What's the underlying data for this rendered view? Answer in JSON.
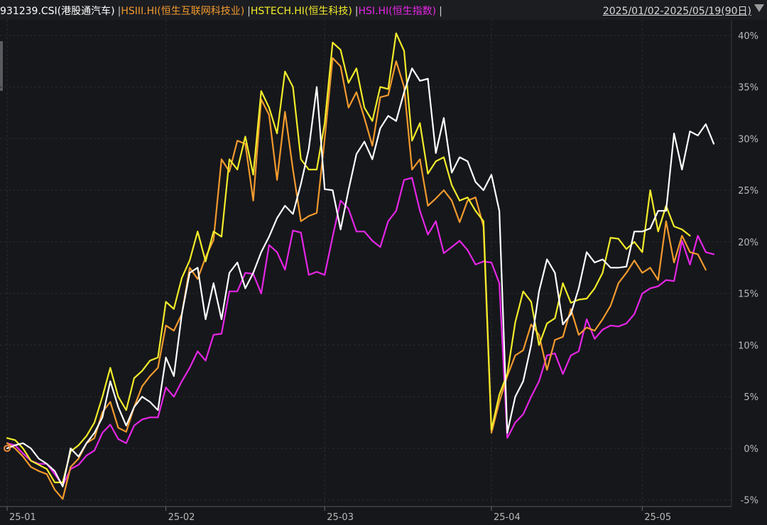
{
  "header": {
    "series_labels": [
      {
        "text": "931239.CSI(港股通汽车)",
        "color": "#ffffff"
      },
      {
        "text": "HSIII.HI(恒生互联网科技业)",
        "color": "#f29a2e"
      },
      {
        "text": "HSTECH.HI(恒生科技)",
        "color": "#f2ec2a"
      },
      {
        "text": "HSI.HI(恒生指数)",
        "color": "#e626e6"
      }
    ],
    "separator": "|",
    "date_range": "2025/01/02-2025/05/19(90日)",
    "dropdown_icon": "triangle-down-icon"
  },
  "chart_data": {
    "type": "line",
    "n_points": 90,
    "ylim": [
      -5.5,
      41.5
    ],
    "y_ticks": [
      -5,
      0,
      5,
      10,
      15,
      20,
      25,
      30,
      35,
      40
    ],
    "y_tick_labels": [
      "-5%",
      "0%",
      "5%",
      "10%",
      "15%",
      "20%",
      "25%",
      "30%",
      "35%",
      "40%"
    ],
    "x_ticks": [
      {
        "label": "25-01",
        "index": 0
      },
      {
        "label": "25-02",
        "index": 20
      },
      {
        "label": "25-03",
        "index": 40
      },
      {
        "label": "25-04",
        "index": 61
      },
      {
        "label": "25-05",
        "index": 80
      }
    ],
    "grid": true,
    "series": [
      {
        "color": "#e626e6",
        "values": [
          0.5,
          0.3,
          -0.5,
          -1.2,
          -1.5,
          -1.5,
          -2.5,
          -3.6,
          -2.0,
          -1.6,
          -0.7,
          -0.2,
          1.5,
          2.3,
          0.9,
          0.5,
          2.2,
          2.8,
          3.0,
          3.0,
          5.9,
          5.0,
          6.5,
          7.8,
          9.4,
          8.5,
          11.0,
          11.1,
          15.2,
          15.2,
          17.0,
          16.9,
          15.0,
          19.7,
          19.0,
          17.3,
          21.1,
          20.9,
          16.8,
          17.1,
          16.8,
          20.5,
          24.0,
          23.2,
          21.0,
          21.0,
          20.1,
          19.5,
          22.0,
          23.0,
          26.0,
          26.2,
          23.0,
          20.7,
          22.0,
          18.9,
          19.5,
          20.1,
          19.2,
          17.8,
          18.1,
          18.0,
          16.0,
          1.0,
          2.5,
          3.3,
          5.0,
          6.5,
          9.0,
          9.2,
          7.2,
          9.0,
          9.4,
          12.5,
          10.6,
          11.5,
          11.9,
          11.8,
          12.1,
          13.0,
          15.0,
          15.5,
          15.7,
          16.3,
          16.2,
          20.1,
          17.8,
          20.6,
          19.0,
          18.8
        ]
      },
      {
        "color": "#f29a2e",
        "values": [
          0.5,
          0.0,
          -0.8,
          -1.8,
          -2.2,
          -2.5,
          -4.0,
          -4.9,
          -1.8,
          -1.0,
          0.5,
          1.0,
          3.5,
          4.5,
          2.0,
          1.6,
          4.0,
          6.0,
          7.0,
          7.8,
          11.9,
          11.4,
          13.0,
          17.5,
          16.4,
          18.5,
          20.2,
          28.0,
          26.8,
          29.8,
          29.5,
          24.0,
          33.8,
          32.3,
          26.0,
          32.6,
          27.0,
          22.0,
          22.5,
          22.8,
          30.0,
          37.8,
          37.0,
          33.0,
          34.5,
          32.0,
          29.3,
          34.0,
          34.2,
          37.5,
          35.0,
          27.0,
          28.0,
          23.5,
          24.2,
          25.0,
          24.0,
          21.9,
          24.0,
          24.3,
          21.5,
          1.5,
          4.5,
          7.0,
          9.0,
          9.5,
          12.0,
          11.0,
          7.6,
          10.5,
          10.8,
          13.5,
          11.0,
          11.7,
          11.4,
          12.5,
          13.8,
          16.0,
          17.0,
          18.2,
          17.0,
          17.5,
          16.3,
          22.0,
          18.0,
          20.6,
          19.0,
          18.8,
          17.3
        ]
      },
      {
        "color": "#f2ec2a",
        "values": [
          1.0,
          0.8,
          0.0,
          -1.2,
          -1.6,
          -2.0,
          -3.3,
          -3.3,
          -0.3,
          0.3,
          1.2,
          2.5,
          5.0,
          7.8,
          5.0,
          3.7,
          6.8,
          7.5,
          8.5,
          8.8,
          14.2,
          13.5,
          16.5,
          18.2,
          21.0,
          18.1,
          21.0,
          20.5,
          28.0,
          27.0,
          30.2,
          26.5,
          34.6,
          33.0,
          30.5,
          36.5,
          35.0,
          28.0,
          27.0,
          27.0,
          31.5,
          39.3,
          38.6,
          35.4,
          36.8,
          33.0,
          31.7,
          35.0,
          34.8,
          40.2,
          38.5,
          29.8,
          31.5,
          26.6,
          27.8,
          28.2,
          25.5,
          24.0,
          24.3,
          23.0,
          22.0,
          1.8,
          5.2,
          7.2,
          12.2,
          15.2,
          14.2,
          10.0,
          12.1,
          12.6,
          16.0,
          14.1,
          14.4,
          14.5,
          15.5,
          17.0,
          20.4,
          20.3,
          19.3,
          20.0,
          19.0,
          25.0,
          21.0,
          23.5,
          21.5,
          21.2,
          20.6
        ]
      },
      {
        "color": "#ffffff",
        "values": [
          0.0,
          0.3,
          0.5,
          0.0,
          -1.0,
          -1.5,
          -2.2,
          -3.7,
          0.0,
          -0.8,
          0.5,
          1.5,
          3.0,
          6.5,
          4.0,
          2.2,
          4.0,
          5.0,
          4.5,
          3.7,
          8.8,
          7.0,
          13.0,
          17.0,
          17.5,
          12.5,
          16.0,
          12.5,
          17.0,
          18.0,
          15.5,
          17.0,
          19.0,
          20.5,
          22.3,
          23.5,
          22.7,
          25.6,
          29.0,
          35.0,
          25.1,
          25.0,
          21.2,
          25.0,
          28.5,
          29.7,
          28.0,
          31.0,
          32.2,
          31.7,
          34.5,
          36.8,
          35.6,
          35.8,
          28.6,
          32.0,
          26.7,
          28.2,
          27.8,
          25.8,
          25.0,
          26.5,
          23.0,
          1.5,
          5.0,
          6.5,
          10.0,
          15.2,
          18.3,
          17.0,
          12.0,
          13.0,
          15.5,
          19.0,
          18.0,
          18.3,
          17.5,
          17.5,
          17.6,
          21.0,
          21.0,
          21.3,
          23.0,
          23.0,
          30.5,
          27.0,
          30.7,
          30.3,
          31.4,
          29.5
        ]
      }
    ]
  }
}
